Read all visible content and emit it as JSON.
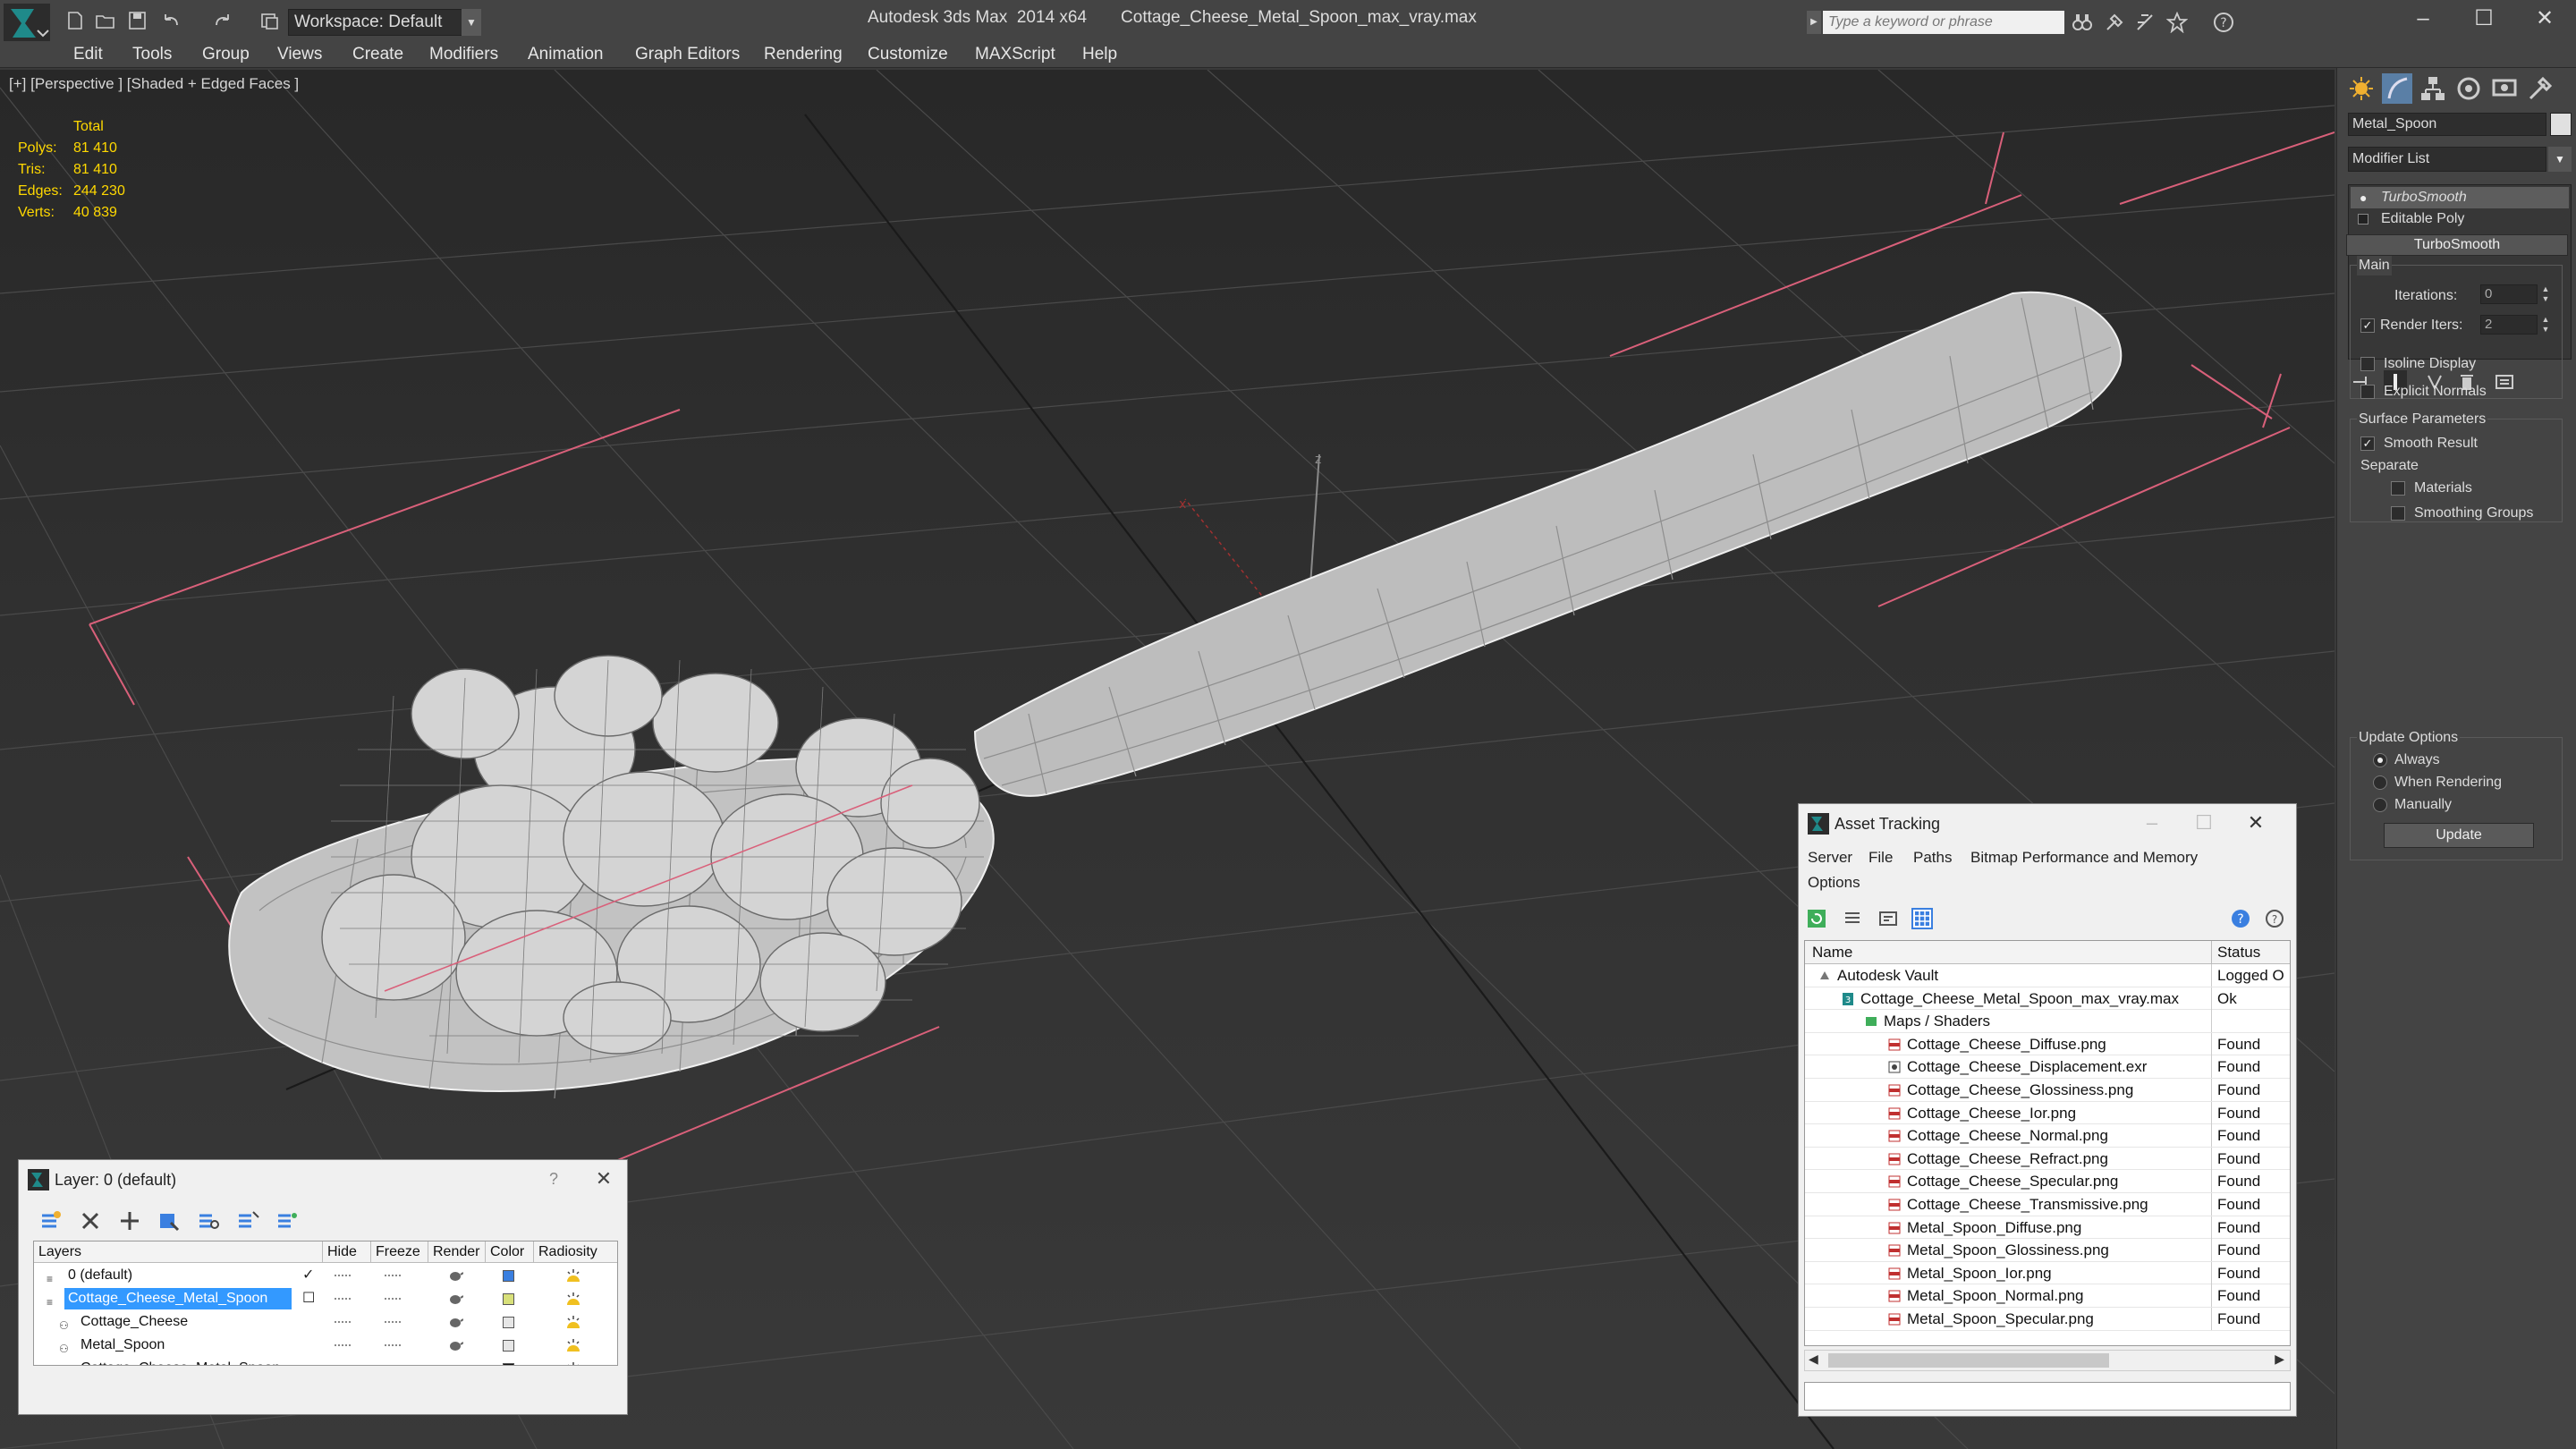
{
  "app": {
    "title": "Autodesk 3ds Max  2014 x64",
    "file": "Cottage_Cheese_Metal_Spoon_max_vray.max",
    "workspace": "Workspace: Default",
    "search_placeholder": "Type a keyword or phrase"
  },
  "menu": [
    "Edit",
    "Tools",
    "Group",
    "Views",
    "Create",
    "Modifiers",
    "Animation",
    "Graph Editors",
    "Rendering",
    "Customize",
    "MAXScript",
    "Help"
  ],
  "viewport": {
    "label": "[+] [Perspective ] [Shaded + Edged Faces ]",
    "stats_header": "Total",
    "stats": [
      {
        "k": "Polys:",
        "v": "81 410"
      },
      {
        "k": "Tris:",
        "v": "81 410"
      },
      {
        "k": "Edges:",
        "v": "244 230"
      },
      {
        "k": "Verts:",
        "v": "40 839"
      }
    ],
    "axis_label": "z",
    "axis_x_label": "x"
  },
  "command_panel": {
    "object_name": "Metal_Spoon",
    "modifier_list": "Modifier List",
    "stack": [
      "TurboSmooth",
      "Editable Poly"
    ],
    "turbosmooth": {
      "title": "TurboSmooth",
      "main": "Main",
      "iterations_label": "Iterations:",
      "iterations": "0",
      "render_iters_label": "Render Iters:",
      "render_iters": "2",
      "isoline": "Isoline Display",
      "explicit_normals": "Explicit Normals",
      "surface_params": "Surface Parameters",
      "smooth_result": "Smooth Result",
      "separate": "Separate",
      "materials": "Materials",
      "smoothing_groups": "Smoothing Groups",
      "update_options": "Update Options",
      "always": "Always",
      "when_rendering": "When Rendering",
      "manually": "Manually",
      "update": "Update"
    }
  },
  "asset_tracking": {
    "title": "Asset Tracking",
    "menu": [
      "Server",
      "File",
      "Paths",
      "Bitmap Performance and Memory",
      "Options"
    ],
    "columns": [
      "Name",
      "Status"
    ],
    "rows": [
      {
        "name": "Autodesk Vault",
        "status": "Logged O",
        "indent": 0,
        "icon": "vault-icon"
      },
      {
        "name": "Cottage_Cheese_Metal_Spoon_max_vray.max",
        "status": "Ok",
        "indent": 1,
        "icon": "max-file-icon"
      },
      {
        "name": "Maps / Shaders",
        "status": "",
        "indent": 2,
        "icon": "maps-folder-icon"
      },
      {
        "name": "Cottage_Cheese_Diffuse.png",
        "status": "Found",
        "indent": 3,
        "icon": "png-file-icon"
      },
      {
        "name": "Cottage_Cheese_Displacement.exr",
        "status": "Found",
        "indent": 3,
        "icon": "exr-file-icon"
      },
      {
        "name": "Cottage_Cheese_Glossiness.png",
        "status": "Found",
        "indent": 3,
        "icon": "png-file-icon"
      },
      {
        "name": "Cottage_Cheese_Ior.png",
        "status": "Found",
        "indent": 3,
        "icon": "png-file-icon"
      },
      {
        "name": "Cottage_Cheese_Normal.png",
        "status": "Found",
        "indent": 3,
        "icon": "png-file-icon"
      },
      {
        "name": "Cottage_Cheese_Refract.png",
        "status": "Found",
        "indent": 3,
        "icon": "png-file-icon"
      },
      {
        "name": "Cottage_Cheese_Specular.png",
        "status": "Found",
        "indent": 3,
        "icon": "png-file-icon"
      },
      {
        "name": "Cottage_Cheese_Transmissive.png",
        "status": "Found",
        "indent": 3,
        "icon": "png-file-icon"
      },
      {
        "name": "Metal_Spoon_Diffuse.png",
        "status": "Found",
        "indent": 3,
        "icon": "png-file-icon"
      },
      {
        "name": "Metal_Spoon_Glossiness.png",
        "status": "Found",
        "indent": 3,
        "icon": "png-file-icon"
      },
      {
        "name": "Metal_Spoon_Ior.png",
        "status": "Found",
        "indent": 3,
        "icon": "png-file-icon"
      },
      {
        "name": "Metal_Spoon_Normal.png",
        "status": "Found",
        "indent": 3,
        "icon": "png-file-icon"
      },
      {
        "name": "Metal_Spoon_Specular.png",
        "status": "Found",
        "indent": 3,
        "icon": "png-file-icon"
      }
    ]
  },
  "layer_manager": {
    "title": "Layer: 0 (default)",
    "help": "?",
    "columns": [
      "Layers",
      "Hide",
      "Freeze",
      "Render",
      "Color",
      "Radiosity"
    ],
    "rows": [
      {
        "name": "0 (default)",
        "indent": 0,
        "color": "#3a7fe0",
        "selected": false,
        "checked": true
      },
      {
        "name": "Cottage_Cheese_Metal_Spoon",
        "indent": 0,
        "color": "#d8e07a",
        "selected": true,
        "checked": false
      },
      {
        "name": "Cottage_Cheese",
        "indent": 1,
        "color": "#e6e6e6",
        "selected": false,
        "checked": false
      },
      {
        "name": "Metal_Spoon",
        "indent": 1,
        "color": "#e6e6e6",
        "selected": false,
        "checked": false
      },
      {
        "name": "Cottage_Cheese_Metal_Spoon",
        "indent": 1,
        "color": "#111111",
        "selected": false,
        "checked": false
      }
    ]
  },
  "colors": {
    "accent_teal": "#1f8a8a",
    "selection": "#3399ff",
    "stats_yellow": "#ffd800",
    "bbox_pink": "#d9607a"
  }
}
